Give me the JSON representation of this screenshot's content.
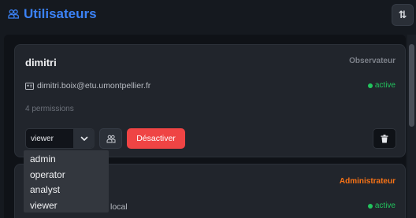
{
  "header": {
    "title": "Utilisateurs",
    "title_color": "#3b82f6",
    "sort_icon": "sort-arrows-icon",
    "sort_glyph": "⇅"
  },
  "users": [
    {
      "username": "dimitri",
      "role_label": "Observateur",
      "email": "dimitri.boix@etu.umontpellier.fr",
      "status": "active",
      "permissions": "4 permissions",
      "role_select": {
        "value": "viewer",
        "options": [
          "admin",
          "operator",
          "analyst",
          "viewer"
        ],
        "expanded": true
      },
      "deactivate_label": "Désactiver"
    },
    {
      "username": "",
      "role_label": "Administrateur",
      "email_visible_part": "local",
      "status": "active"
    }
  ],
  "colors": {
    "accent": "#3b82f6",
    "status_active": "#22c55e",
    "danger": "#ef4444",
    "admin_role": "#f97316"
  }
}
